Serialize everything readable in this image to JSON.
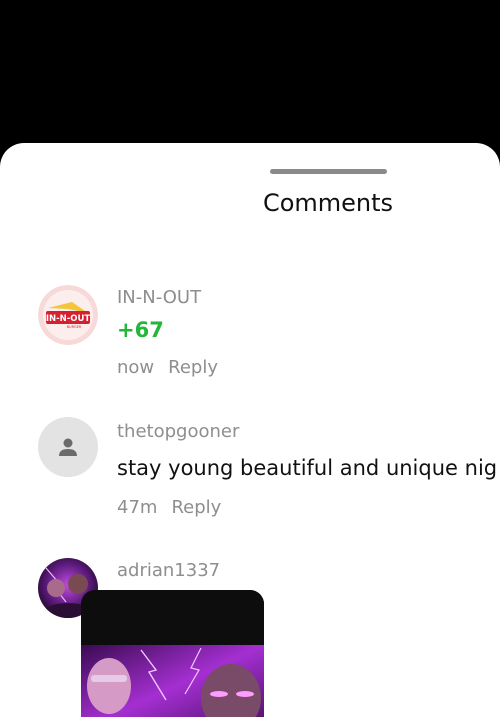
{
  "sheet": {
    "title": "Comments"
  },
  "comments": [
    {
      "username": "IN-N-OUT",
      "text": "+67",
      "time": "now",
      "reply": "Reply",
      "logo_text": "IN-N-OUT",
      "logo_sub": "BURGER"
    },
    {
      "username": "thetopgooner",
      "text": "stay young beautiful and unique nig",
      "time": "47m",
      "reply": "Reply"
    },
    {
      "username": "adrian1337"
    }
  ],
  "icons": {
    "default_avatar": "person-icon"
  },
  "colors": {
    "delta_green": "#23b63a",
    "muted_text": "#8e8e8e",
    "sheet_bg": "#ffffff",
    "scrim": "#000000"
  }
}
